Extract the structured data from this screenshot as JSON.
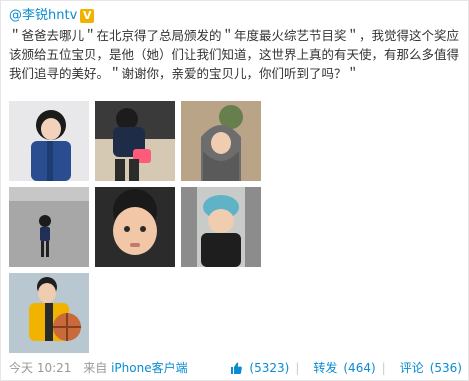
{
  "post": {
    "author": "@李锐hntv",
    "verified_badge": "V",
    "text": "＂爸爸去哪儿＂在北京得了总局颁发的＂年度最火综艺节目奖＂，我觉得这个奖应该颁给五位宝贝，是他（她）们让我们知道，这世界上真的有天使，有那么多值得我们追寻的美好。＂谢谢你，亲爱的宝贝儿，你们听到了吗？＂",
    "images": [
      {
        "name": "photo-girl-blue-jacket"
      },
      {
        "name": "photo-boy-bending-down"
      },
      {
        "name": "photo-kid-in-hood"
      },
      {
        "name": "photo-girl-standing-plaza"
      },
      {
        "name": "photo-boy-closeup-face"
      },
      {
        "name": "photo-kid-in-car"
      },
      {
        "name": "photo-boy-with-ball"
      }
    ],
    "footer": {
      "time": "今天 10:21",
      "from_prefix": "来自",
      "source": "iPhone客户端",
      "likes": "(5323)",
      "repost_label": "转发",
      "repost_count": "(464)",
      "comment_label": "评论",
      "comment_count": "(536)"
    }
  },
  "colors": {
    "link": "#0a8cd2",
    "muted": "#999999",
    "badge": "#f2b200"
  }
}
